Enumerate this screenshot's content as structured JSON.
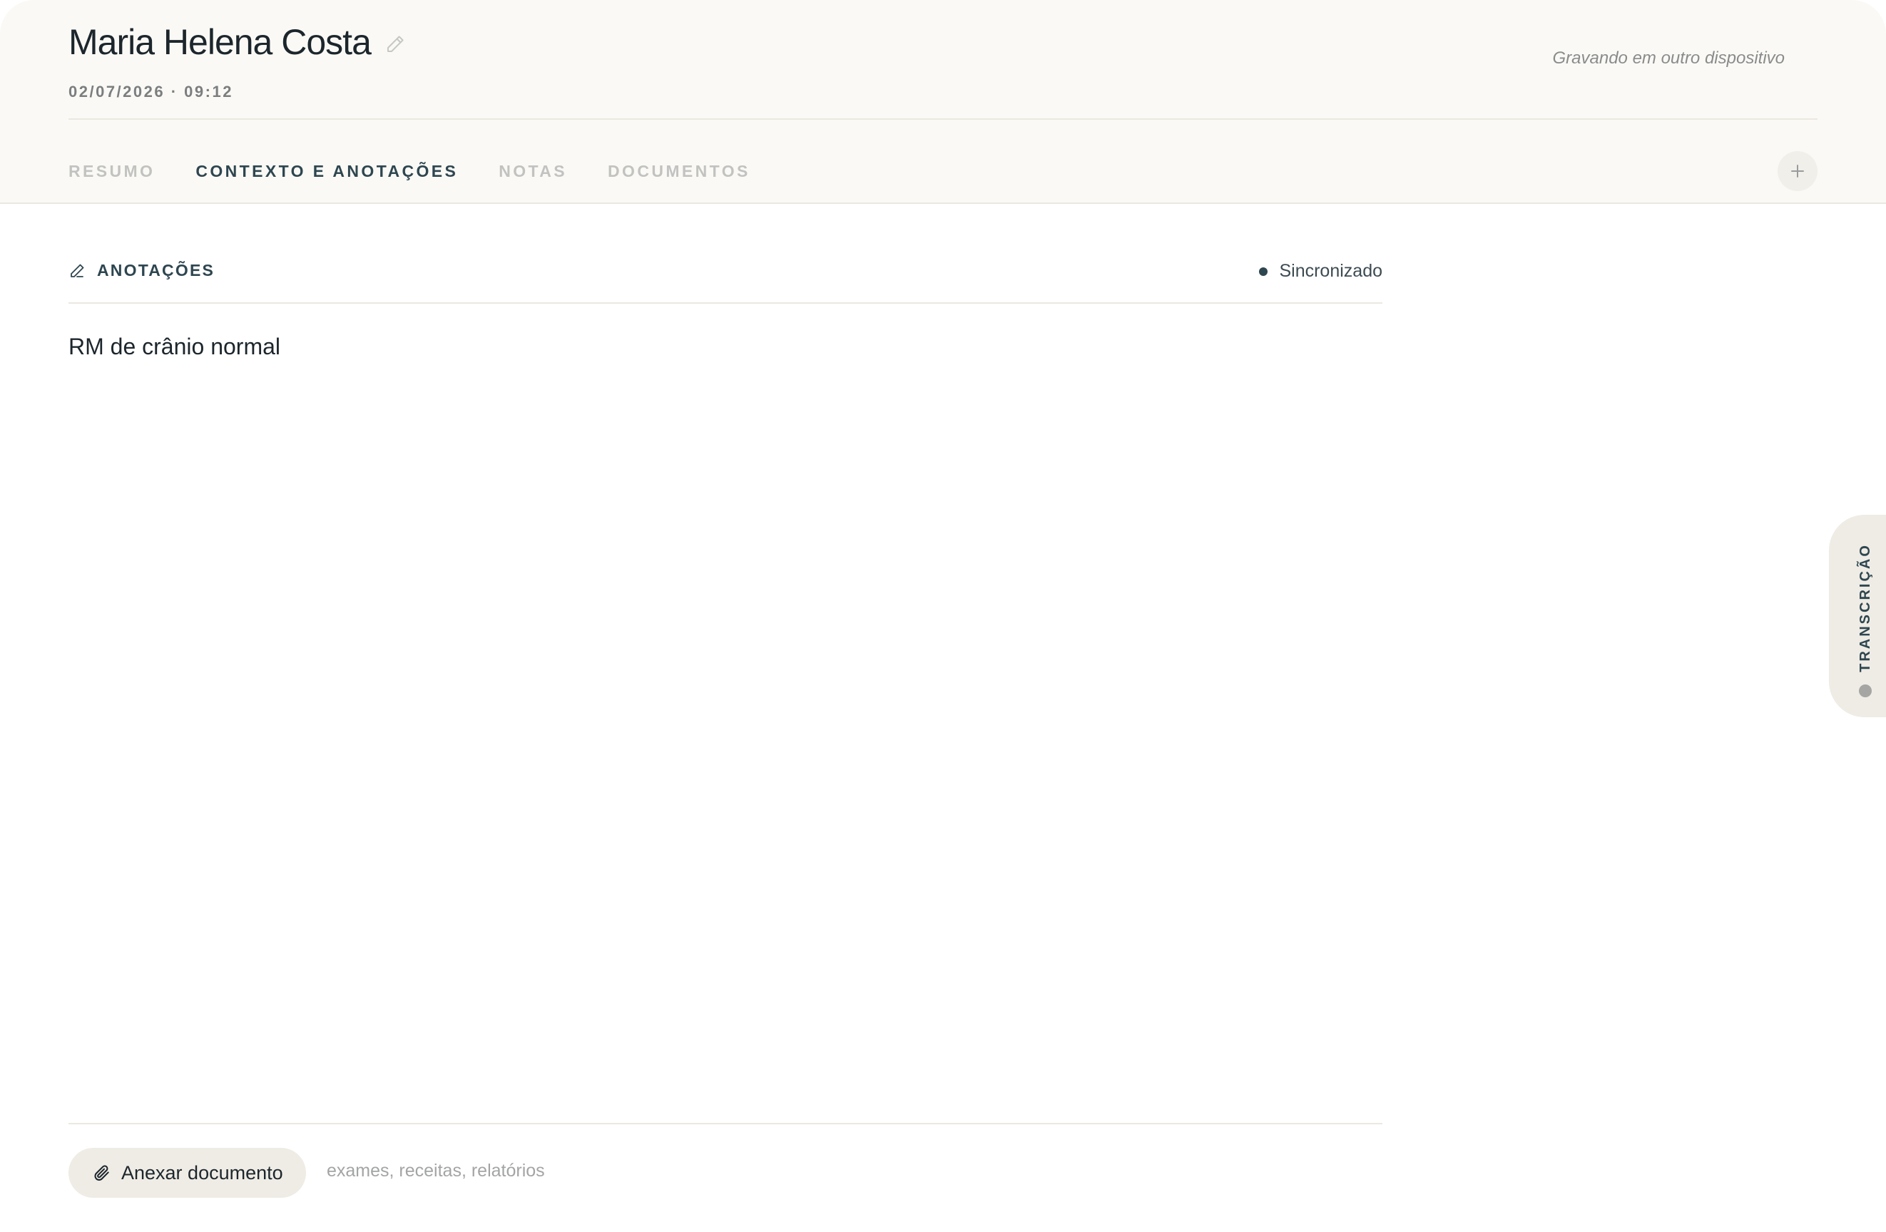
{
  "header": {
    "patient_name": "Maria Helena Costa",
    "datetime": "02/07/2026 · 09:12",
    "recording_status": "Gravando em outro dispositivo"
  },
  "tabs": [
    {
      "label": "RESUMO",
      "active": false
    },
    {
      "label": "CONTEXTO E ANOTAÇÕES",
      "active": true
    },
    {
      "label": "NOTAS",
      "active": false
    },
    {
      "label": "DOCUMENTOS",
      "active": false
    }
  ],
  "add_tab_icon": "plus-icon",
  "annotations": {
    "title": "ANOTAÇÕES",
    "title_icon": "pencil-icon",
    "sync_status": "Sincronizado",
    "content": "RM de crânio normal"
  },
  "attachments": {
    "button_label": "Anexar documento",
    "button_icon": "paperclip-icon",
    "hint": "exames, receitas, relatórios"
  },
  "side_panel": {
    "label": "TRANSCRIÇÃO"
  },
  "colors": {
    "header_background": "#faf9f5",
    "accent": "#2e4650",
    "chip_background": "#efece5"
  }
}
